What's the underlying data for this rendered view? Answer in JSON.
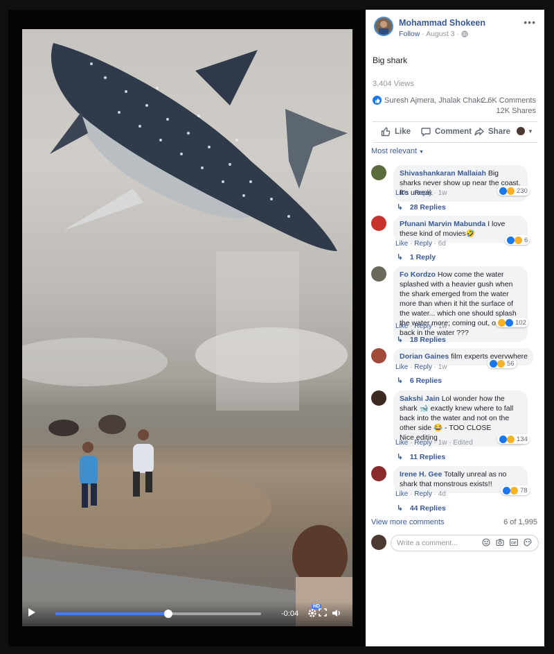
{
  "video": {
    "time": "-0:04",
    "progress": 0.55,
    "hd_label": "HD",
    "icons": [
      "play-icon",
      "settings-icon",
      "fullscreen-icon",
      "volume-icon"
    ]
  },
  "post": {
    "author": "Mohammad Shokeen",
    "follow": "Follow",
    "date": "August 3",
    "privacy_icon": "globe-icon",
    "text": "Big shark",
    "views": "3,404 Views",
    "reactors": "Suresh Ajmera, Jhalak Chakr...",
    "comments_count": "2.6K Comments",
    "shares_count": "12K Shares"
  },
  "actions": {
    "like": "Like",
    "comment": "Comment",
    "share": "Share"
  },
  "sort_label": "Most relevant",
  "comments": [
    {
      "name": "Shivashankaran Mallaiah",
      "lines": [
        "Big sharks never",
        "show up near the coast. It's unreal."
      ],
      "reaction_count": "230",
      "like": "Like",
      "reply": "Reply",
      "age": "1w",
      "edited": "",
      "replies": "28 Replies"
    },
    {
      "name": "Pfunani Marvin Mabunda",
      "lines": [
        "I love these kind",
        "of movies🤣"
      ],
      "reaction_count": "6",
      "like": "Like",
      "reply": "Reply",
      "age": "6d",
      "edited": "",
      "replies": "1 Reply"
    },
    {
      "name": "Fo Kordzo",
      "lines": [
        "How come the water splashed",
        "with a heavier gush when the shark",
        "emerged from the water more than when it",
        "hit the surface of the water... which one",
        "should splash the water more; coming out,",
        "or falling back in the water ???"
      ],
      "reaction_count": "102",
      "like": "Like",
      "reply": "Reply",
      "age": "1w",
      "edited": "",
      "replies": "18 Replies"
    },
    {
      "name": "Dorian Gaines",
      "lines": [
        "film experts everywhere"
      ],
      "reaction_count": "56",
      "like": "Like",
      "reply": "Reply",
      "age": "1w",
      "edited": "",
      "replies": "6 Replies"
    },
    {
      "name": "Sakshi Jain",
      "lines": [
        "Lol wonder how the shark 🐋",
        "exactly knew where to fall back into the",
        "water and not on the other side 😂 - TOO",
        "CLOSE",
        "Nice editing"
      ],
      "reaction_count": "134",
      "like": "Like",
      "reply": "Reply",
      "age": "1w",
      "edited": "Edited",
      "replies": "11 Replies"
    },
    {
      "name": "Irene H. Gee",
      "lines": [
        "Totally unreal as no shark that",
        "monstrous exists!!"
      ],
      "reaction_count": "78",
      "like": "Like",
      "reply": "Reply",
      "age": "4d",
      "edited": "",
      "replies": "44 Replies"
    }
  ],
  "view_more": "View more comments",
  "page_count": "6 of 1,995",
  "write_placeholder": "Write a comment..."
}
